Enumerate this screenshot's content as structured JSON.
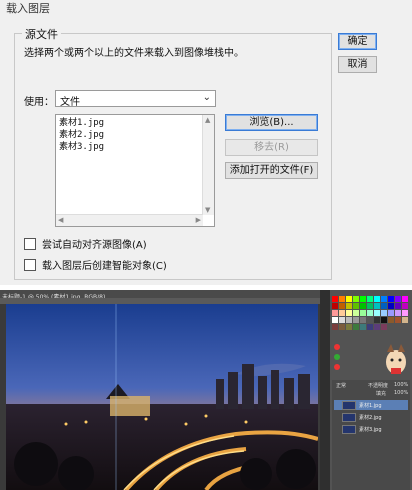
{
  "dialog": {
    "title": "载入图层",
    "group_title": "源文件",
    "description": "选择两个或两个以上的文件来载入到图像堆栈中。",
    "use_label": "使用：",
    "use_value": "文件",
    "files": [
      "素材1.jpg",
      "素材2.jpg",
      "素材3.jpg"
    ],
    "buttons": {
      "ok": "确定",
      "cancel": "取消",
      "browse": "浏览(B)...",
      "remove": "移去(R)",
      "add_open": "添加打开的文件(F)"
    },
    "options": {
      "auto_align": "尝试自动对齐源图像(A)",
      "smart_object": "载入图层后创建智能对象(C)"
    }
  },
  "photoshop": {
    "doc_tab": "未标题-1 @ 50% (素材1.jpg, RGB/8)",
    "layers": [
      "素材1.jpg",
      "素材2.jpg",
      "素材3.jpg"
    ],
    "blend_label": "正常",
    "opacity_label": "不透明度",
    "opacity_value": "100%",
    "fill_label": "填充",
    "fill_value": "100%"
  },
  "colors": {
    "dialog_bg": "#f0f0f0",
    "accent": "#3a7bd5",
    "ps_dark": "#3a3a3a"
  }
}
